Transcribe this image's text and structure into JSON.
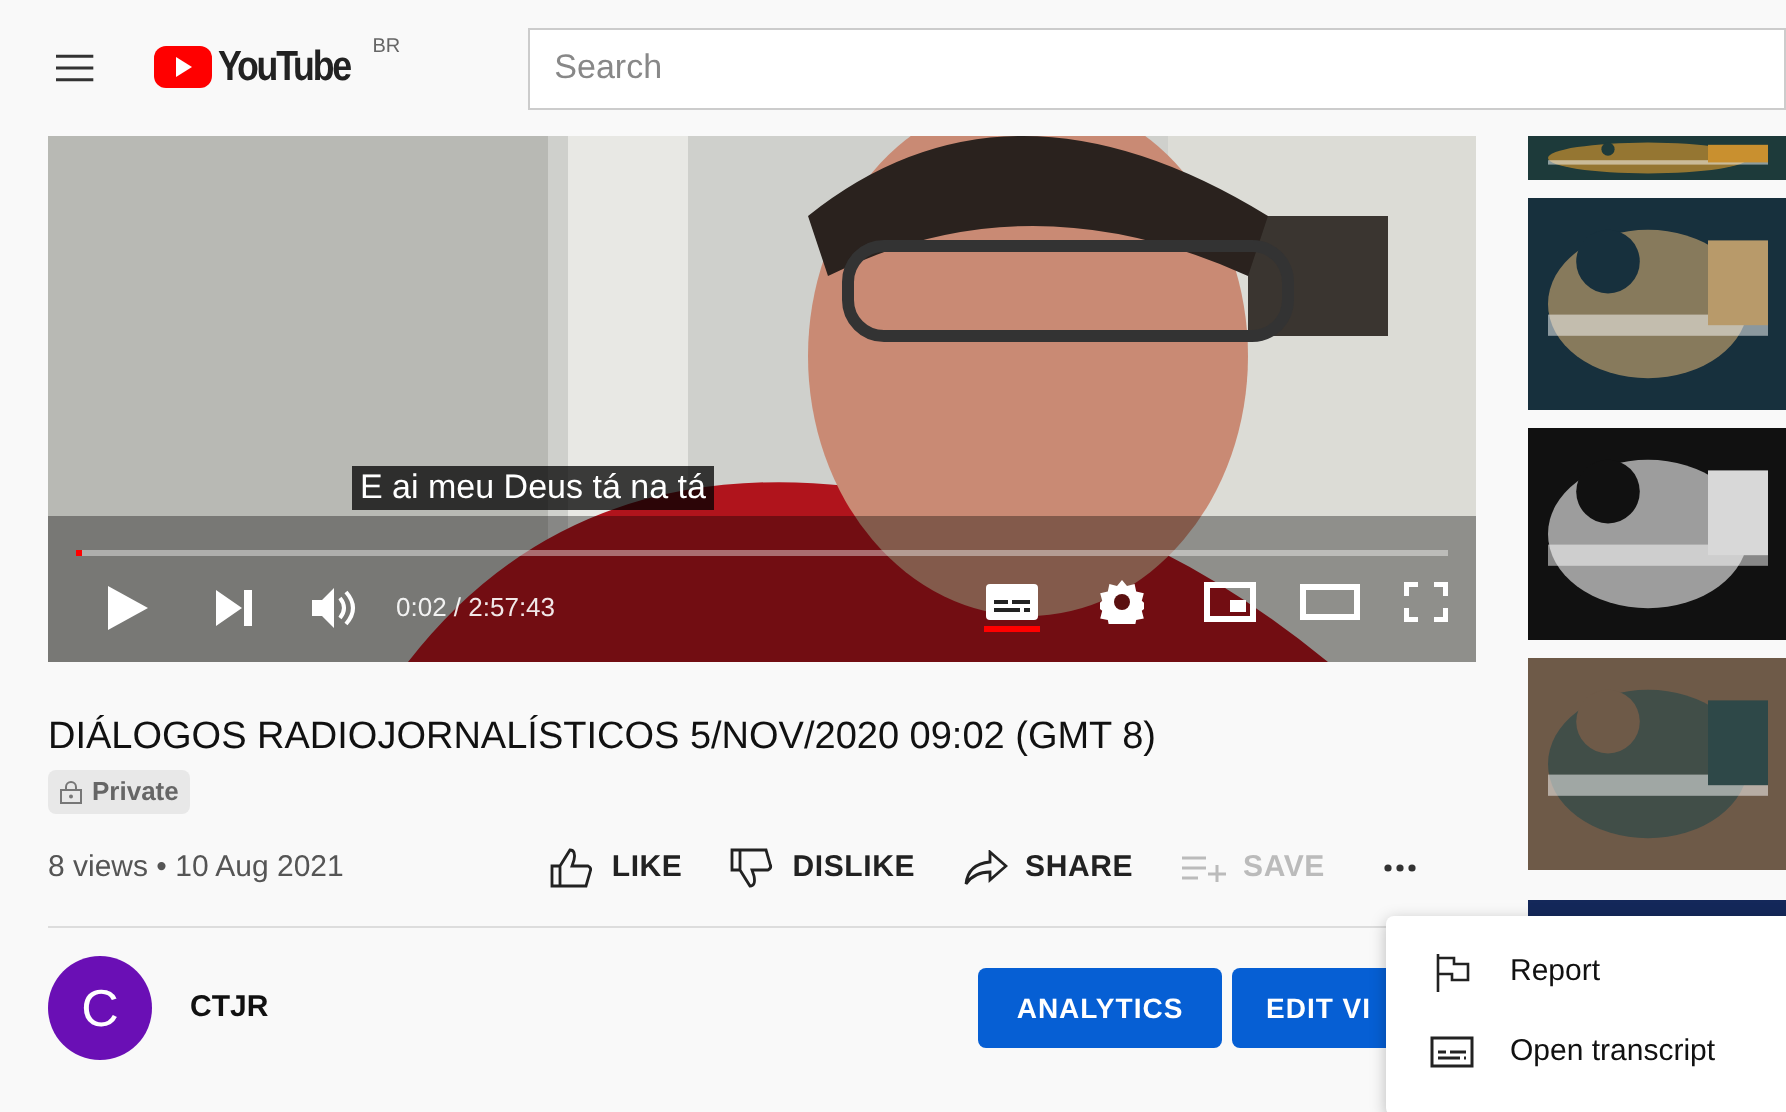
{
  "header": {
    "logo_text": "YouTube",
    "region": "BR",
    "search": {
      "placeholder": "Search"
    }
  },
  "player": {
    "caption": "E ai meu Deus tá na tá",
    "progress": {
      "level": 0.004
    },
    "time": "0:02 / 2:57:43",
    "captions_on": true
  },
  "video": {
    "title": "DIÁLOGOS RADIOJORNALÍSTICOS 5/NOV/2020 09:02 (GMT 8)",
    "privacy": "Private",
    "meta": "8 views • 10 Aug 2021",
    "actions": [
      {
        "kind": "like",
        "label": "LIKE",
        "disabled": false
      },
      {
        "kind": "dislike",
        "label": "DISLIKE",
        "disabled": false
      },
      {
        "kind": "share",
        "label": "SHARE",
        "disabled": false
      },
      {
        "kind": "save",
        "label": "SAVE",
        "disabled": true
      }
    ]
  },
  "channel": {
    "avatar_letter": "C",
    "name": "CTJR",
    "buttons": [
      "ANALYTICS",
      "EDIT VI"
    ]
  },
  "menu": [
    {
      "kind": "flag",
      "label": "Report"
    },
    {
      "kind": "transcript",
      "label": "Open transcript"
    }
  ]
}
